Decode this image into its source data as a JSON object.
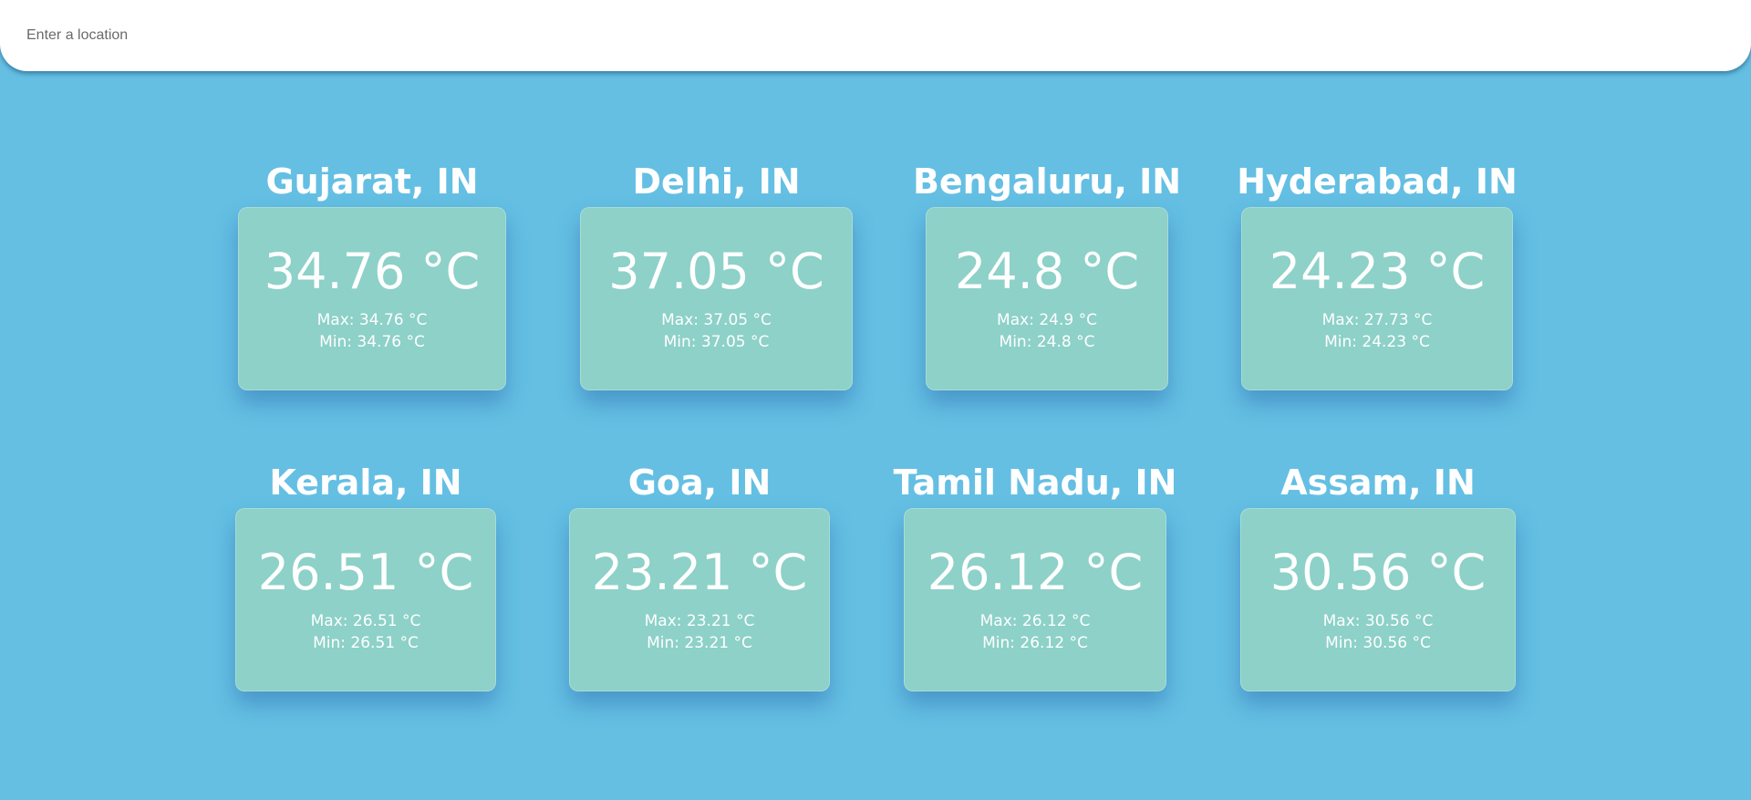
{
  "search": {
    "placeholder": "Enter a location",
    "value": ""
  },
  "locations": [
    {
      "name": "Gujarat, IN",
      "temp": "34.76 °C",
      "max": "Max: 34.76 °C",
      "min": "Min: 34.76 °C"
    },
    {
      "name": "Delhi, IN",
      "temp": "37.05 °C",
      "max": "Max: 37.05 °C",
      "min": "Min: 37.05 °C"
    },
    {
      "name": "Bengaluru, IN",
      "temp": "24.8 °C",
      "max": "Max: 24.9 °C",
      "min": "Min: 24.8 °C"
    },
    {
      "name": "Hyderabad, IN",
      "temp": "24.23 °C",
      "max": "Max: 27.73 °C",
      "min": "Min: 24.23 °C"
    },
    {
      "name": "Kerala, IN",
      "temp": "26.51 °C",
      "max": "Max: 26.51 °C",
      "min": "Min: 26.51 °C"
    },
    {
      "name": "Goa, IN",
      "temp": "23.21 °C",
      "max": "Max: 23.21 °C",
      "min": "Min: 23.21 °C"
    },
    {
      "name": "Tamil Nadu, IN",
      "temp": "26.12 °C",
      "max": "Max: 26.12 °C",
      "min": "Min: 26.12 °C"
    },
    {
      "name": "Assam, IN",
      "temp": "30.56 °C",
      "max": "Max: 30.56 °C",
      "min": "Min: 30.56 °C"
    }
  ],
  "colors": {
    "background": "#64bfe3",
    "card": "#8dd1c8",
    "text": "#ffffff"
  }
}
